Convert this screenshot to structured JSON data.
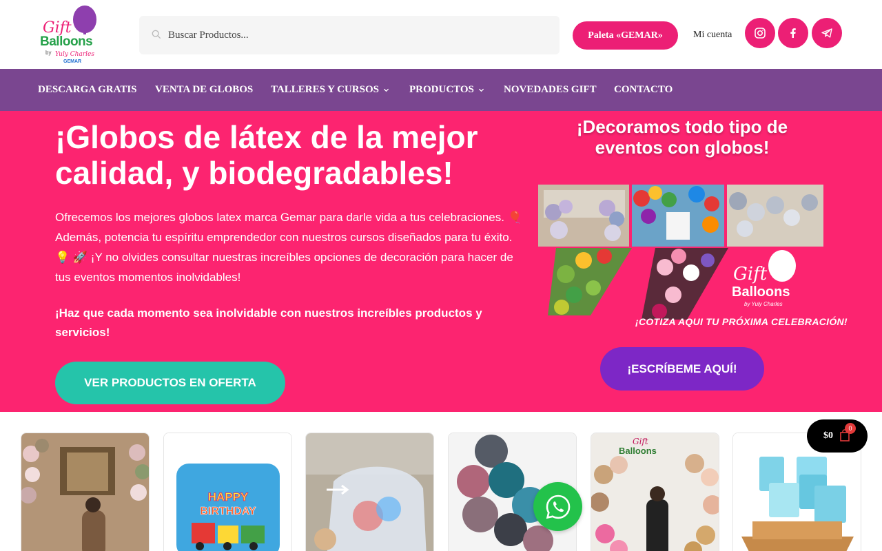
{
  "header": {
    "logo": {
      "gift": "Gift",
      "balloons": "Balloons",
      "by": "by",
      "signature": "Yuly Charles",
      "partner": "GEMAR"
    },
    "search": {
      "placeholder": "Buscar Productos..."
    },
    "paleta_button": "Paleta «GEMAR»",
    "account_link": "Mi cuenta",
    "social": [
      {
        "icon": "instagram-icon"
      },
      {
        "icon": "facebook-icon"
      },
      {
        "icon": "telegram-icon"
      }
    ]
  },
  "nav": {
    "items": [
      {
        "label": "DESCARGA GRATIS",
        "dropdown": false
      },
      {
        "label": "VENTA DE GLOBOS",
        "dropdown": false
      },
      {
        "label": "TALLERES Y CURSOS",
        "dropdown": true
      },
      {
        "label": "PRODUCTOS",
        "dropdown": true
      },
      {
        "label": "NOVEDADES GIFT",
        "dropdown": false
      },
      {
        "label": "CONTACTO",
        "dropdown": false
      }
    ]
  },
  "hero": {
    "title": "¡Globos de látex de la mejor calidad, y biodegradables!",
    "paragraph": "Ofrecemos los mejores globos latex marca  Gemar para darle vida a tus celebraciones. 🎈 Además, potencia tu espíritu emprendedor con nuestros cursos diseñados para tu éxito. 💡 🚀 ¡Y no olvides consultar nuestras increíbles opciones de decoración para hacer de tus eventos momentos inolvidables!",
    "bold_text": "¡Haz que cada momento sea inolvidable con nuestros increíbles productos y servicios!",
    "cta_button": "VER PRODUCTOS EN OFERTA",
    "side_title": "¡Decoramos todo tipo de eventos con globos!",
    "collage": {
      "logo_gift": "Gift",
      "logo_balloons": "Balloons",
      "logo_by": "by Yuly Charles",
      "caption": "¡COTIZA AQUI TU PRÓXIMA CELEBRACIÓN!"
    },
    "contact_button": "¡ESCRÍBEME AQUÍ!"
  },
  "products": {
    "cards": [
      {
        "name": "product-card-decoracion-arco"
      },
      {
        "name": "product-card-happy-birthday"
      },
      {
        "name": "product-card-bolsa-globos"
      },
      {
        "name": "product-card-globos-cromados"
      },
      {
        "name": "product-card-arco-dorado"
      },
      {
        "name": "product-card-paquetes-gemar"
      }
    ]
  },
  "cart": {
    "amount": "$0",
    "count": "0"
  },
  "colors": {
    "brand_pink": "#fc2470",
    "nav_purple": "#7a4690",
    "teal": "#25c4aa",
    "violet": "#7d27c6",
    "whatsapp_green": "#23c24b"
  }
}
